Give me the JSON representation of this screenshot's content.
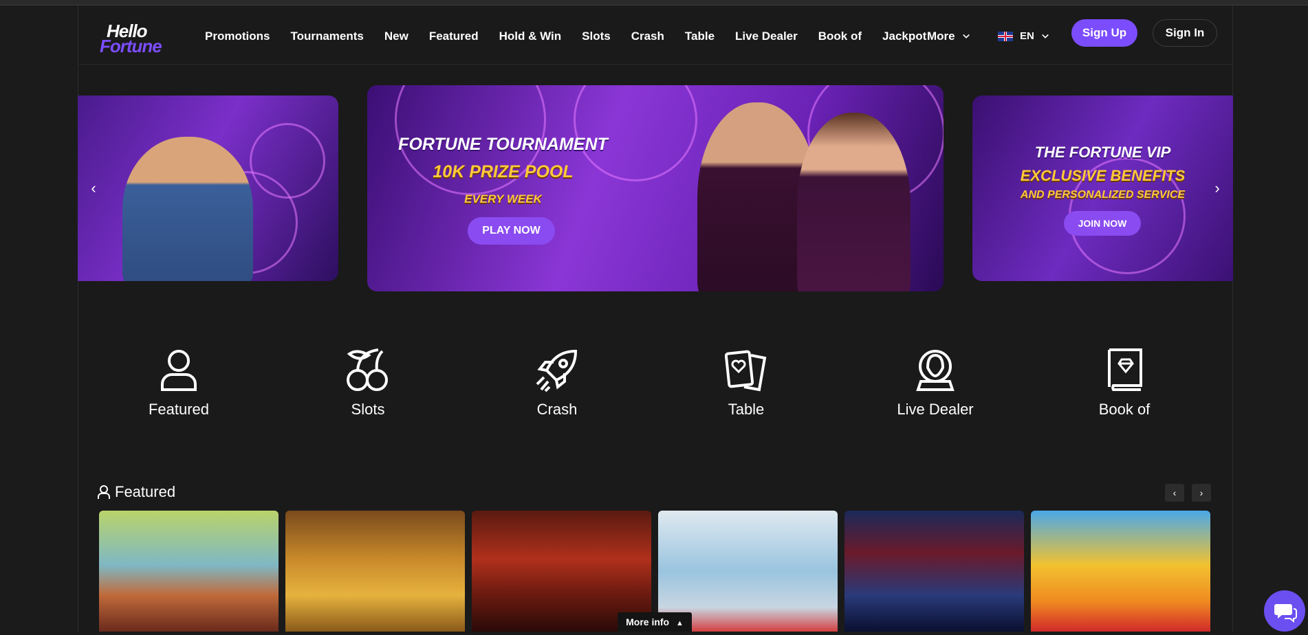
{
  "header": {
    "logo_line1": "Hello",
    "logo_line2": "Fortune",
    "nav": [
      "Promotions",
      "Tournaments",
      "New",
      "Featured",
      "Hold & Win",
      "Slots",
      "Crash",
      "Table",
      "Live Dealer",
      "Book of",
      "Jackpot"
    ],
    "more_label": "More",
    "lang_label": "EN",
    "signup_label": "Sign Up",
    "signin_label": "Sign In"
  },
  "carousel": {
    "center": {
      "line1": "FORTUNE TOURNAMENT",
      "line2": "10K PRIZE POOL",
      "line3": "EVERY WEEK",
      "button": "PLAY NOW"
    },
    "right": {
      "line1": "THE FORTUNE VIP",
      "line2": "EXCLUSIVE BENEFITS",
      "line3": "AND PERSONALIZED SERVICE",
      "button": "JOIN NOW"
    }
  },
  "categories": [
    {
      "label": "Featured",
      "icon": "user-icon"
    },
    {
      "label": "Slots",
      "icon": "cherries-icon"
    },
    {
      "label": "Crash",
      "icon": "rocket-icon"
    },
    {
      "label": "Table",
      "icon": "cards-icon"
    },
    {
      "label": "Live Dealer",
      "icon": "dealer-icon"
    },
    {
      "label": "Book of",
      "icon": "book-icon"
    }
  ],
  "featured_section": {
    "title": "Featured",
    "more_info": "More info"
  },
  "colors": {
    "accent": "#7b4dff",
    "background": "#1b1b1b",
    "gold": "#ffc93a"
  }
}
